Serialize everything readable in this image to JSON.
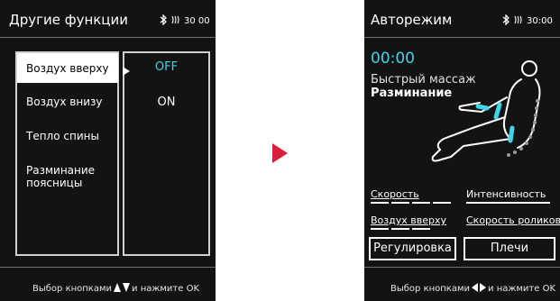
{
  "left_screen": {
    "title": "Другие функции",
    "status": {
      "bluetooth_icon": "bluetooth-icon",
      "signal_icon": "signal-icon",
      "time": "30 00"
    },
    "menu_items": [
      {
        "label": "Воздух вверху",
        "selected": true
      },
      {
        "label": "Воздух внизу",
        "selected": false
      },
      {
        "label": "Тепло спины",
        "selected": false
      },
      {
        "label": "Разминание поясницы",
        "selected": false
      }
    ],
    "options": [
      {
        "label": "OFF",
        "active": true
      },
      {
        "label": "ON",
        "active": false
      }
    ],
    "footer": {
      "prefix": "Выбор кнопками",
      "suffix": "и нажмите OK"
    }
  },
  "arrow": {
    "icon": "arrow-right-icon",
    "color": "#d8203a"
  },
  "right_screen": {
    "title": "Авторежим",
    "status": {
      "bluetooth_icon": "bluetooth-icon",
      "signal_icon": "signal-icon",
      "time": "30:00"
    },
    "timer": "00:00",
    "mode_label": "Быстрый массаж",
    "mode_value": "Разминание",
    "controls": {
      "speed_label": "Скорость",
      "speed_level": 0.5,
      "intensity_label": "Интенсивность",
      "air_top_label": "Воздух вверху",
      "air_top_level": 0.5,
      "roller_speed_label": "Скорость роликов"
    },
    "buttons": {
      "adjust": "Регулировка",
      "shoulders": "Плечи"
    },
    "footer": {
      "prefix": "Выбор кнопками",
      "suffix": "и нажмите OK"
    }
  },
  "colors": {
    "screen_bg": "#131313",
    "accent_cyan": "#3fd4e8",
    "arrow": "#d8203a"
  }
}
